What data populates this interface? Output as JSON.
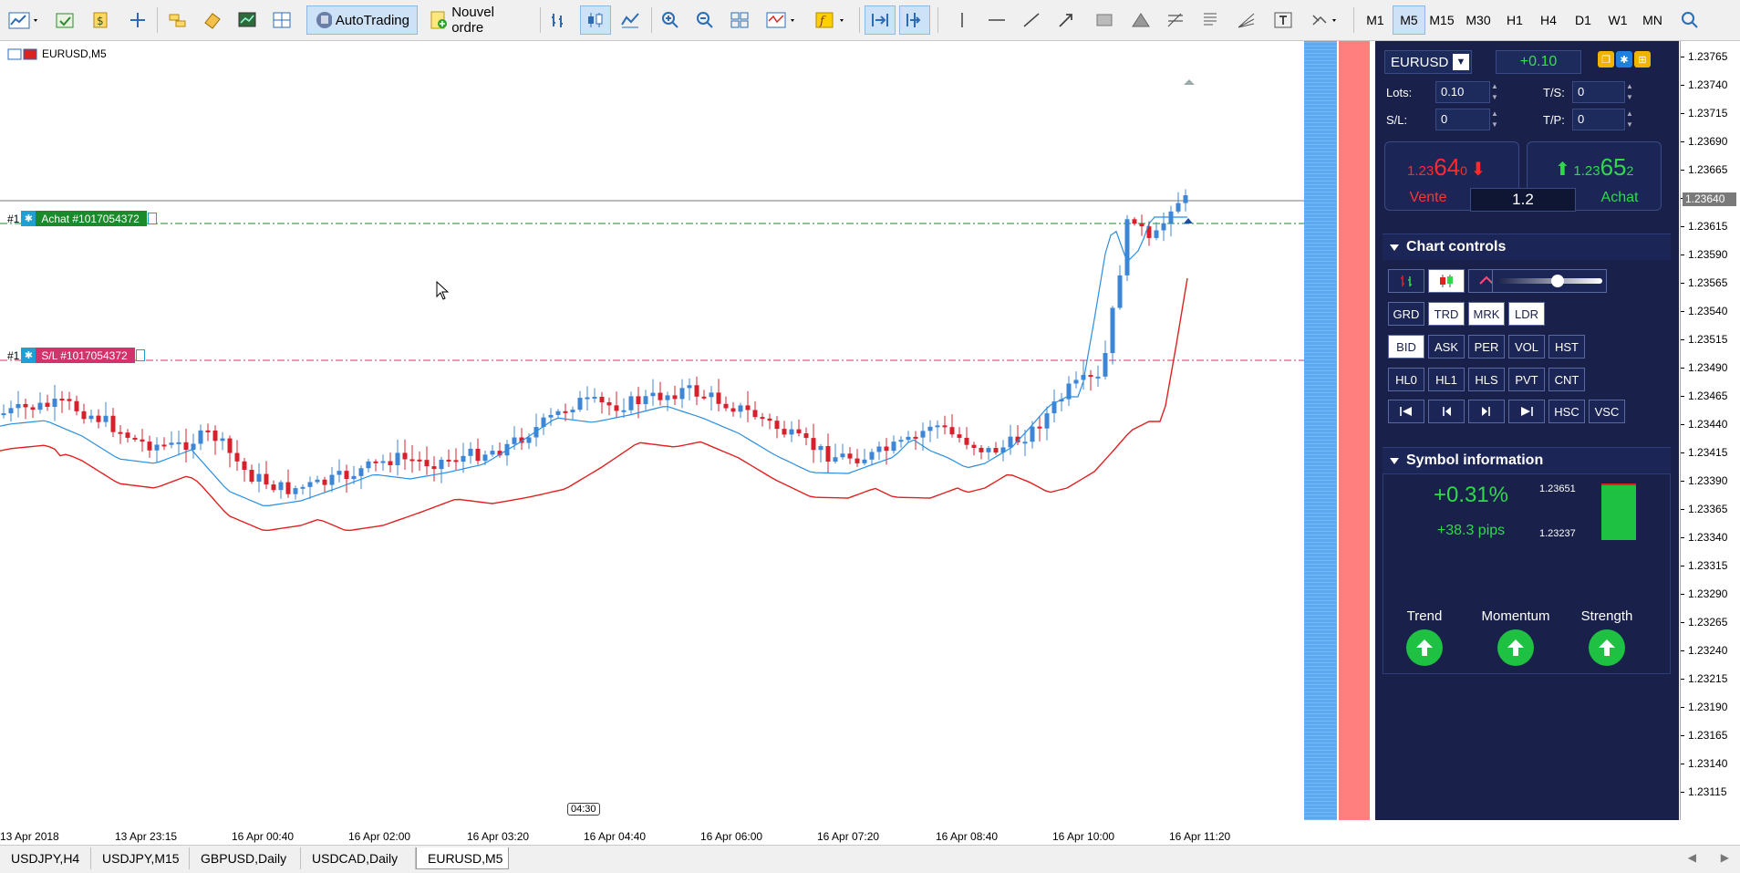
{
  "toolbar": {
    "autotrading_label": "AutoTrading",
    "new_order_label": "Nouvel ordre",
    "timeframes": [
      "M1",
      "M5",
      "M15",
      "M30",
      "H1",
      "H4",
      "D1",
      "W1",
      "MN"
    ],
    "active_timeframe": "M5"
  },
  "chart": {
    "title": "EURUSD,M5",
    "buy_line": {
      "prefix": "#1",
      "label": "Achat #1017054372",
      "color": "#1a8a2a"
    },
    "sl_line": {
      "prefix": "#1",
      "label": "S/L #1017054372",
      "color": "#d2336b"
    },
    "cursor_time": "04:30",
    "time_labels": [
      "13 Apr 2018",
      "13 Apr 23:15",
      "16 Apr 00:40",
      "16 Apr 02:00",
      "16 Apr 03:20",
      "16 Apr 04:40",
      "16 Apr 06:00",
      "16 Apr 07:20",
      "16 Apr 08:40",
      "16 Apr 10:00",
      "16 Apr 11:20"
    ],
    "price_ticks": [
      "1.23765",
      "1.23740",
      "1.23715",
      "1.23690",
      "1.23665",
      "1.23640",
      "1.23615",
      "1.23590",
      "1.23565",
      "1.23540",
      "1.23515",
      "1.23490",
      "1.23465",
      "1.23440",
      "1.23415",
      "1.23390",
      "1.23365",
      "1.23340",
      "1.23315",
      "1.23290",
      "1.23265",
      "1.23240",
      "1.23215",
      "1.23190",
      "1.23165",
      "1.23140",
      "1.23115"
    ],
    "current_price": "1.23640",
    "bull_color": "#3d86d6",
    "bear_color": "#d6202c"
  },
  "panel": {
    "symbol": "EURUSD",
    "profit": "+0.10",
    "lots_label": "Lots:",
    "lots_value": "0.10",
    "ts_label": "T/S:",
    "ts_value": "0",
    "sl_label": "S/L:",
    "sl_value": "0",
    "tp_label": "T/P:",
    "tp_value": "0",
    "sell_price_small": "1.23",
    "sell_price_big": "64",
    "sell_price_frac": "0",
    "buy_price_small": "1.23",
    "buy_price_big": "65",
    "buy_price_frac": "2",
    "sell_label": "Vente",
    "buy_label": "Achat",
    "spread": "1.2",
    "chart_controls_title": "Chart controls",
    "row2": [
      "GRD",
      "TRD",
      "MRK",
      "LDR"
    ],
    "row2_on": [
      "TRD",
      "MRK",
      "LDR"
    ],
    "row3": [
      "BID",
      "ASK",
      "PER",
      "VOL",
      "HST"
    ],
    "row3_on": [
      "BID"
    ],
    "row4": [
      "HL0",
      "HL1",
      "HLS",
      "PVT",
      "CNT"
    ],
    "row5_text": [
      "HSC",
      "VSC"
    ],
    "symbol_info_title": "Symbol information",
    "change_pct": "+0.31%",
    "change_pips": "+38.3 pips",
    "range_high": "1.23651",
    "range_low": "1.23237",
    "indicators": [
      "Trend",
      "Momentum",
      "Strength"
    ]
  },
  "tabs": [
    "USDJPY,H4",
    "USDJPY,M15",
    "GBPUSD,Daily",
    "USDCAD,Daily",
    "EURUSD,M5"
  ],
  "active_tab": "EURUSD,M5"
}
